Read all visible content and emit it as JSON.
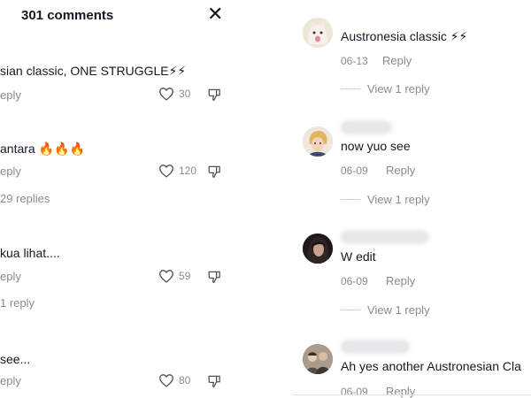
{
  "header": {
    "title": "301 comments",
    "close_glyph": "✕"
  },
  "left_comments": [
    {
      "text": "sian classic, ONE STRUGGLE⚡⚡",
      "reply": "eply",
      "likes": "30"
    },
    {
      "text": "antara 🔥🔥🔥",
      "reply": "eply",
      "likes": "120",
      "view_replies": "29 replies"
    },
    {
      "text": " kua lihat....",
      "reply": "eply",
      "likes": "59",
      "view_replies": "1 reply"
    },
    {
      "text": "see...",
      "reply": "eply",
      "likes": "80"
    }
  ],
  "right_comments": [
    {
      "text": "Austronesia classic ⚡⚡",
      "date": "06-13",
      "reply": "Reply",
      "view_replies": "View 1 reply",
      "avatar_icon": "cat-avatar-icon",
      "avatar_color": "#e9dccd"
    },
    {
      "text": "now yuo see",
      "date": "06-09",
      "reply": "Reply",
      "view_replies": "View 1 reply",
      "avatar_icon": "cartoon-avatar-icon",
      "avatar_color": "#d7c6b8"
    },
    {
      "text": "W edit",
      "date": "06-09",
      "reply": "Reply",
      "view_replies": "View 1 reply",
      "avatar_icon": "dark-portrait-avatar-icon",
      "avatar_color": "#2a2222"
    },
    {
      "text": "Ah yes another Austronesian Cla",
      "date": "06-09",
      "reply": "Reply",
      "avatar_icon": "group-avatar-icon",
      "avatar_color": "#8a7f74"
    }
  ],
  "colors": {
    "text": "#161823",
    "muted": "#8a8b91",
    "divider": "#d0d1d4"
  },
  "icons": {
    "like": "heart-outline-icon",
    "dislike": "thumbs-down-icon",
    "close": "close-icon"
  }
}
